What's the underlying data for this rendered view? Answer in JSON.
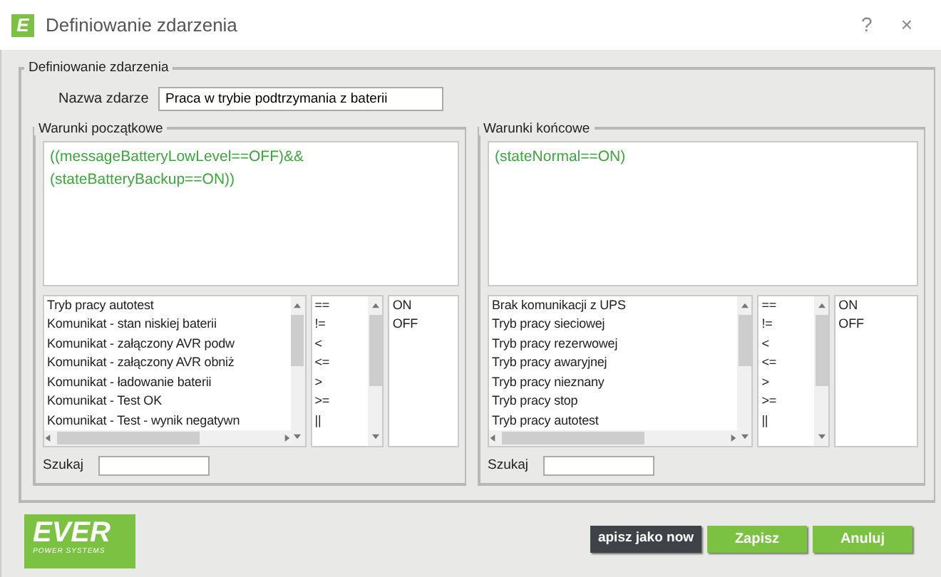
{
  "window": {
    "title": "Definiowanie zdarzenia",
    "help": "?",
    "close": "×",
    "icon_letter": "E"
  },
  "event_group": {
    "legend": "Definiowanie zdarzenia",
    "name_label": "Nazwa zdarze",
    "name_value": "Praca w trybie podtrzymania z baterii"
  },
  "panels": [
    {
      "legend": "Warunki początkowe",
      "expression": "((messageBatteryLowLevel==OFF)&&(stateBatteryBackup==ON))",
      "variables": [
        "Tryb pracy autotest",
        "Komunikat - stan niskiej baterii",
        "Komunikat - załączony AVR podw",
        "Komunikat - załączony AVR obniż",
        "Komunikat - ładowanie baterii",
        "Komunikat - Test OK",
        "Komunikat - Test - wynik negatywn"
      ],
      "operators": [
        "==",
        "!=",
        "<",
        "<=",
        ">",
        ">=",
        "||"
      ],
      "values": [
        "ON",
        "OFF"
      ],
      "search_label": "Szukaj"
    },
    {
      "legend": "Warunki końcowe",
      "expression": "(stateNormal==ON)",
      "variables": [
        "Brak komunikacji z UPS",
        "Tryb pracy sieciowej",
        "Tryb pracy rezerwowej",
        "Tryb pracy awaryjnej",
        "Tryb pracy nieznany",
        "Tryb pracy stop",
        "Tryb pracy autotest"
      ],
      "operators": [
        "==",
        "!=",
        "<",
        "<=",
        ">",
        ">=",
        "||"
      ],
      "values": [
        "ON",
        "OFF"
      ],
      "search_label": "Szukaj"
    }
  ],
  "logo": {
    "brand": "EVER",
    "tagline": "POWER SYSTEMS"
  },
  "buttons": [
    {
      "label": "apisz jako now",
      "kind": "dark"
    },
    {
      "label": "Zapisz",
      "kind": "green"
    },
    {
      "label": "Anuluj",
      "kind": "green"
    }
  ]
}
